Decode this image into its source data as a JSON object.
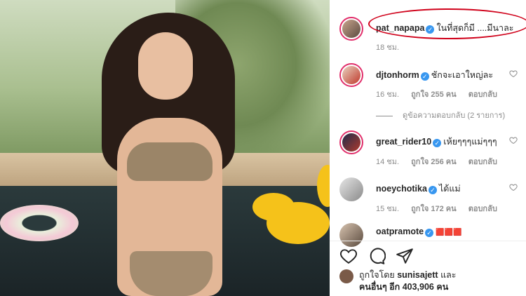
{
  "comments": [
    {
      "username": "pat_napapa",
      "text": "ในที่สุดก็มี ....มีนาละ",
      "time": "18 ชม."
    },
    {
      "username": "djtonhorm",
      "text": "ชักจะเอาใหญ่ละ",
      "time": "16 ชม.",
      "likes": "ถูกใจ 255 คน",
      "reply": "ตอบกลับ"
    },
    {
      "username": "great_rider10",
      "text": "เห้ยๆๆๆแม่ๆๆๆ",
      "time": "14 ชม.",
      "likes": "ถูกใจ 256 คน",
      "reply": "ตอบกลับ"
    },
    {
      "username": "noeychotika",
      "text": "ได้แม่",
      "time": "15 ชม.",
      "likes": "ถูกใจ 172 คน",
      "reply": "ตอบกลับ"
    },
    {
      "username": "oatpramote",
      "text": "🟥🟥🟥"
    }
  ],
  "view_replies": "ดูข้อความตอบกลับ (2 รายการ)",
  "likes_line1_prefix": "ถูกใจโดย",
  "likes_user": "sunisajett",
  "likes_line1_suffix": "และ",
  "likes_line2": "คนอื่นๆ อีก 403,906 คน",
  "colors": {
    "verified": "#3897f0",
    "highlight": "#d0021b",
    "story_ring": "#e1306c"
  }
}
